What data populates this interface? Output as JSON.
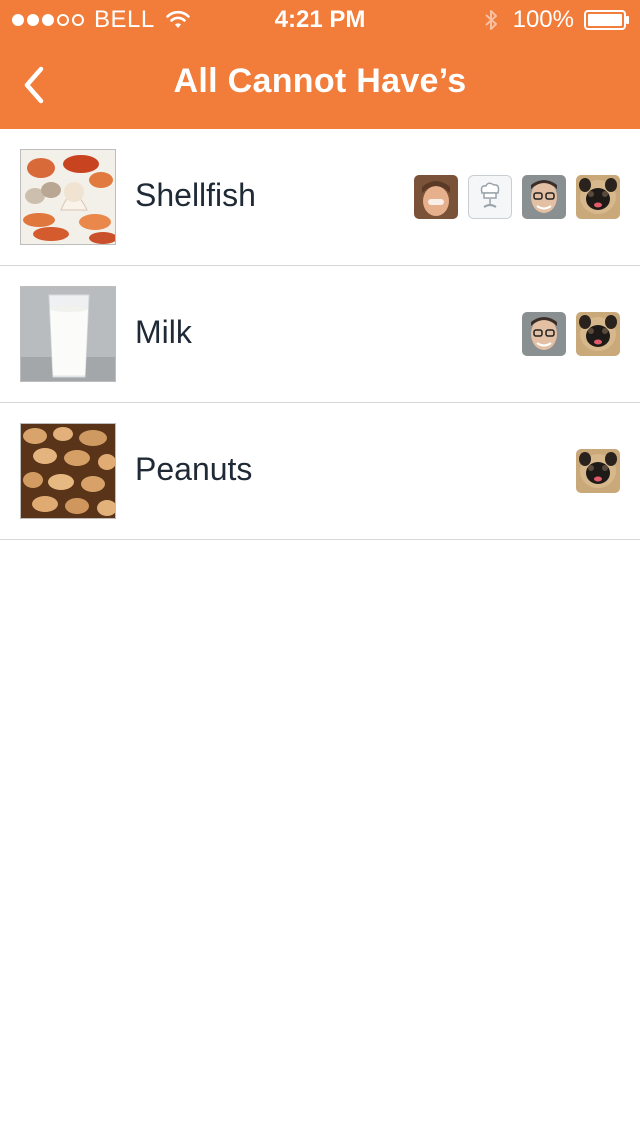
{
  "status_bar": {
    "signal_dots_filled": 3,
    "signal_dots_total": 5,
    "carrier": "BELL",
    "time": "4:21 PM",
    "battery": "100%",
    "battery_level": 1.0
  },
  "nav": {
    "title": "All Cannot Have’s",
    "back_icon": "chevron-left-icon"
  },
  "colors": {
    "header": "#f27c3a",
    "divider": "#d7d7d7",
    "text": "#1f2a36"
  },
  "items": [
    {
      "label": "Shellfish",
      "image": "shellfish-photo",
      "avatars": [
        "avatar-child",
        "avatar-chef-placeholder",
        "avatar-man-glasses",
        "avatar-pug"
      ]
    },
    {
      "label": "Milk",
      "image": "milk-glass-photo",
      "avatars": [
        "avatar-man-glasses",
        "avatar-pug"
      ]
    },
    {
      "label": "Peanuts",
      "image": "peanuts-photo",
      "avatars": [
        "avatar-pug"
      ]
    }
  ]
}
